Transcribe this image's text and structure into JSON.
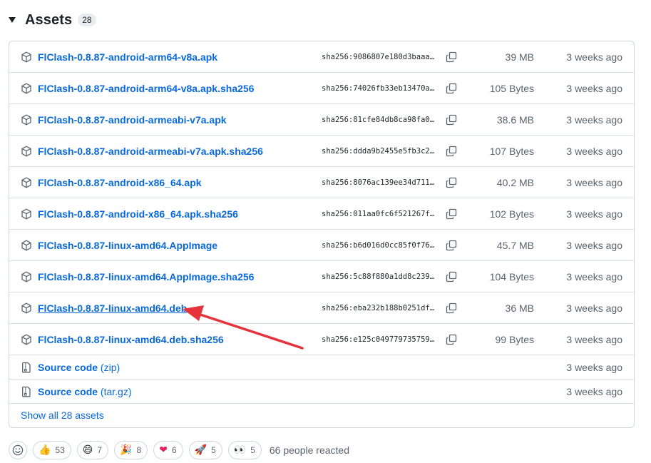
{
  "header": {
    "title": "Assets",
    "count": "28"
  },
  "assets": [
    {
      "name": "FlClash-0.8.87-android-arm64-v8a.apk",
      "sha": "sha256:9086807e180d3baaa…",
      "size": "39 MB",
      "time": "3 weeks ago"
    },
    {
      "name": "FlClash-0.8.87-android-arm64-v8a.apk.sha256",
      "sha": "sha256:74026fb33eb13470a…",
      "size": "105 Bytes",
      "time": "3 weeks ago"
    },
    {
      "name": "FlClash-0.8.87-android-armeabi-v7a.apk",
      "sha": "sha256:81cfe84db8ca98fa0…",
      "size": "38.6 MB",
      "time": "3 weeks ago"
    },
    {
      "name": "FlClash-0.8.87-android-armeabi-v7a.apk.sha256",
      "sha": "sha256:ddda9b2455e5fb3c2…",
      "size": "107 Bytes",
      "time": "3 weeks ago"
    },
    {
      "name": "FlClash-0.8.87-android-x86_64.apk",
      "sha": "sha256:8076ac139ee34d711…",
      "size": "40.2 MB",
      "time": "3 weeks ago"
    },
    {
      "name": "FlClash-0.8.87-android-x86_64.apk.sha256",
      "sha": "sha256:011aa0fc6f521267f…",
      "size": "102 Bytes",
      "time": "3 weeks ago"
    },
    {
      "name": "FlClash-0.8.87-linux-amd64.AppImage",
      "sha": "sha256:b6d016d0cc85f0f76…",
      "size": "45.7 MB",
      "time": "3 weeks ago"
    },
    {
      "name": "FlClash-0.8.87-linux-amd64.AppImage.sha256",
      "sha": "sha256:5c88f880a1dd8c239…",
      "size": "104 Bytes",
      "time": "3 weeks ago"
    },
    {
      "name": "FlClash-0.8.87-linux-amd64.deb",
      "sha": "sha256:eba232b188b0251df…",
      "size": "36 MB",
      "time": "3 weeks ago"
    },
    {
      "name": "FlClash-0.8.87-linux-amd64.deb.sha256",
      "sha": "sha256:e125c049779735759…",
      "size": "99 Bytes",
      "time": "3 weeks ago"
    }
  ],
  "source": [
    {
      "label": "Source code",
      "paren": "(zip)",
      "time": "3 weeks ago"
    },
    {
      "label": "Source code",
      "paren": "(tar.gz)",
      "time": "3 weeks ago"
    }
  ],
  "show_all": "Show all 28 assets",
  "reactions": {
    "items": [
      {
        "emoji": "👍",
        "count": "53"
      },
      {
        "emoji": "😄",
        "count": "7"
      },
      {
        "emoji": "🎉",
        "count": "8"
      },
      {
        "emoji": "❤",
        "count": "6"
      },
      {
        "emoji": "🚀",
        "count": "5"
      },
      {
        "emoji": "👀",
        "count": "5"
      }
    ],
    "summary": "66 people reacted"
  },
  "colors": {
    "link": "#0969da",
    "muted": "#59636e",
    "border": "#d0d7de",
    "annotation_arrow": "#e5323b"
  }
}
